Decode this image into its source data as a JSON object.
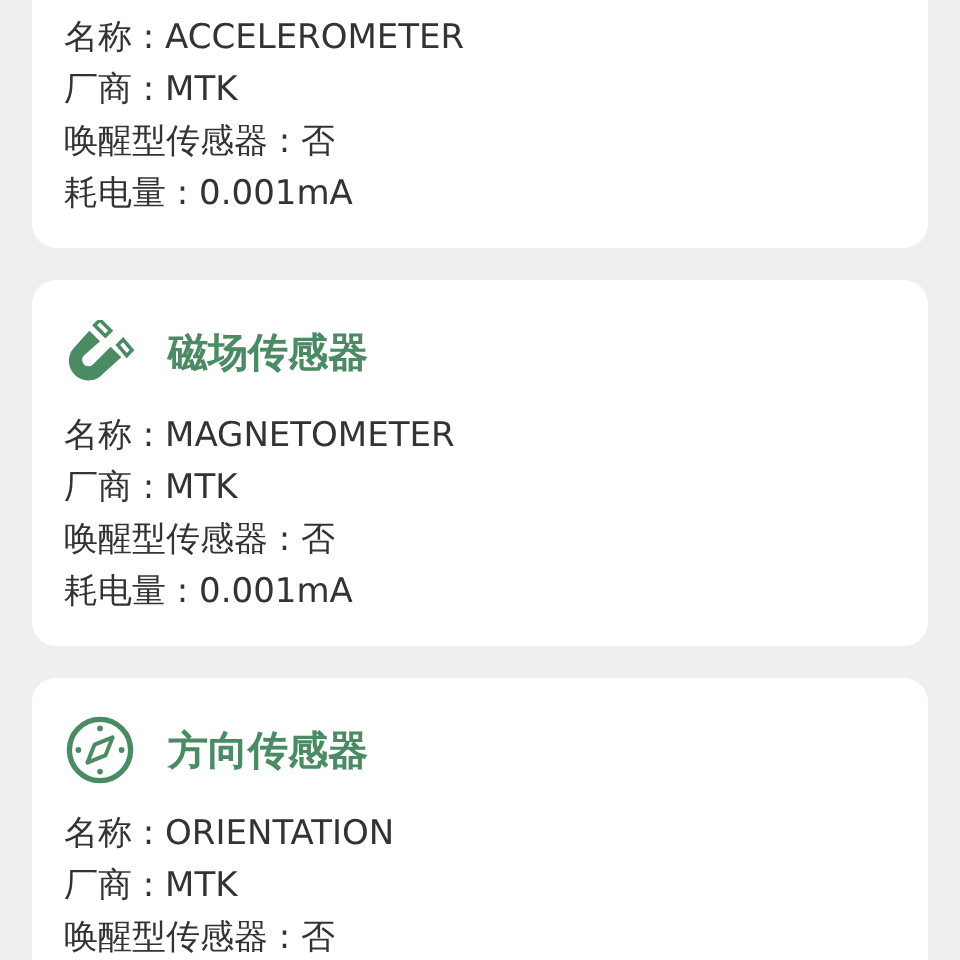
{
  "sensors": [
    {
      "fields": [
        "名称 : ACCELEROMETER",
        "厂商 : MTK",
        "唤醒型传感器 : 否",
        "耗电量 : 0.001mA"
      ]
    },
    {
      "kind": "magnet",
      "title": "磁场传感器",
      "fields": [
        "名称 : MAGNETOMETER",
        "厂商 : MTK",
        "唤醒型传感器 : 否",
        "耗电量 : 0.001mA"
      ]
    },
    {
      "kind": "compass",
      "title": "方向传感器",
      "fields": [
        "名称 : ORIENTATION",
        "厂商 : MTK",
        "唤醒型传感器 : 否"
      ]
    }
  ]
}
